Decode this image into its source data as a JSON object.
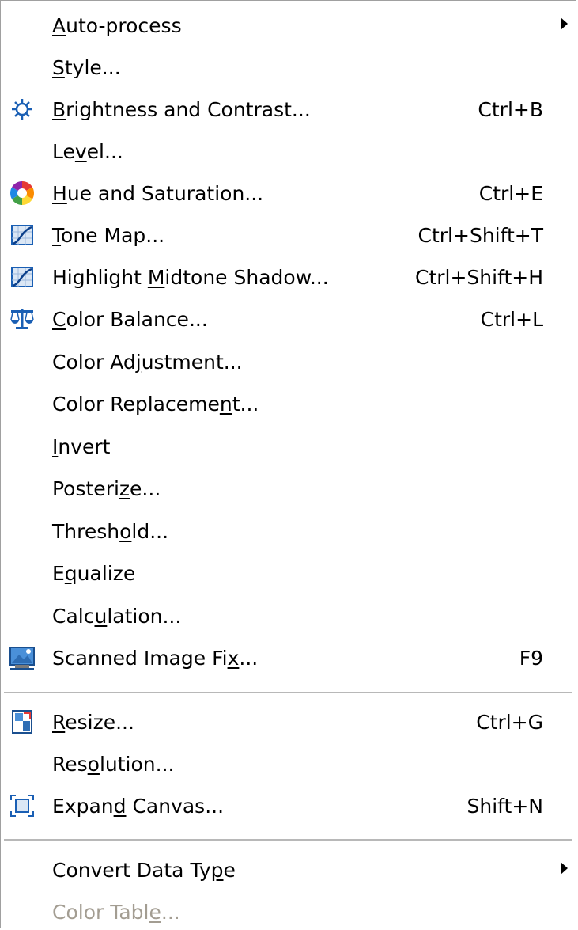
{
  "menu": {
    "items": [
      {
        "id": "auto-process",
        "pre": "",
        "ul": "A",
        "post": "uto-process",
        "shortcut": "",
        "submenu": true,
        "icon": "",
        "disabled": false
      },
      {
        "id": "style",
        "pre": "",
        "ul": "S",
        "post": "tyle...",
        "shortcut": "",
        "submenu": false,
        "icon": "",
        "disabled": false
      },
      {
        "id": "brightness-contrast",
        "pre": "",
        "ul": "B",
        "post": "rightness and Contrast...",
        "shortcut": "Ctrl+B",
        "submenu": false,
        "icon": "sun-icon",
        "disabled": false
      },
      {
        "id": "level",
        "pre": "Le",
        "ul": "v",
        "post": "el...",
        "shortcut": "",
        "submenu": false,
        "icon": "",
        "disabled": false
      },
      {
        "id": "hue-saturation",
        "pre": "",
        "ul": "H",
        "post": "ue and Saturation...",
        "shortcut": "Ctrl+E",
        "submenu": false,
        "icon": "color-wheel-icon",
        "disabled": false
      },
      {
        "id": "tone-map",
        "pre": "",
        "ul": "T",
        "post": "one Map...",
        "shortcut": "Ctrl+Shift+T",
        "submenu": false,
        "icon": "curve-graph-icon",
        "disabled": false
      },
      {
        "id": "highlight-midtone-shadow",
        "pre": "Highlight ",
        "ul": "M",
        "post": "idtone Shadow...",
        "shortcut": "Ctrl+Shift+H",
        "submenu": false,
        "icon": "curve-graph-icon",
        "disabled": false
      },
      {
        "id": "color-balance",
        "pre": "",
        "ul": "C",
        "post": "olor Balance...",
        "shortcut": "Ctrl+L",
        "submenu": false,
        "icon": "balance-scale-icon",
        "disabled": false
      },
      {
        "id": "color-adjustment",
        "pre": "Color Ad",
        "ul": "j",
        "post": "ustment...",
        "shortcut": "",
        "submenu": false,
        "icon": "",
        "disabled": false
      },
      {
        "id": "color-replacement",
        "pre": "Color Replaceme",
        "ul": "n",
        "post": "t...",
        "shortcut": "",
        "submenu": false,
        "icon": "",
        "disabled": false
      },
      {
        "id": "invert",
        "pre": "",
        "ul": "I",
        "post": "nvert",
        "shortcut": "",
        "submenu": false,
        "icon": "",
        "disabled": false
      },
      {
        "id": "posterize",
        "pre": "Posteri",
        "ul": "z",
        "post": "e...",
        "shortcut": "",
        "submenu": false,
        "icon": "",
        "disabled": false
      },
      {
        "id": "threshold",
        "pre": "Thresh",
        "ul": "o",
        "post": "ld...",
        "shortcut": "",
        "submenu": false,
        "icon": "",
        "disabled": false
      },
      {
        "id": "equalize",
        "pre": "E",
        "ul": "q",
        "post": "ualize",
        "shortcut": "",
        "submenu": false,
        "icon": "",
        "disabled": false
      },
      {
        "id": "calculation",
        "pre": "Calc",
        "ul": "u",
        "post": "lation...",
        "shortcut": "",
        "submenu": false,
        "icon": "",
        "disabled": false
      },
      {
        "id": "scanned-image-fix",
        "pre": "Scanned Image Fi",
        "ul": "x",
        "post": "...",
        "shortcut": "F9",
        "submenu": false,
        "icon": "scanned-image-icon",
        "disabled": false
      },
      {
        "id": "resize",
        "pre": "",
        "ul": "R",
        "post": "esize...",
        "shortcut": "Ctrl+G",
        "submenu": false,
        "icon": "resize-icon",
        "disabled": false
      },
      {
        "id": "resolution",
        "pre": "Res",
        "ul": "o",
        "post": "lution...",
        "shortcut": "",
        "submenu": false,
        "icon": "",
        "disabled": false
      },
      {
        "id": "expand-canvas",
        "pre": "Expan",
        "ul": "d",
        "post": " Canvas...",
        "shortcut": "Shift+N",
        "submenu": false,
        "icon": "expand-canvas-icon",
        "disabled": false
      },
      {
        "id": "convert-data-type",
        "pre": "Convert Data Ty",
        "ul": "p",
        "post": "e",
        "shortcut": "",
        "submenu": true,
        "icon": "",
        "disabled": false
      },
      {
        "id": "color-table",
        "pre": "Color Tabl",
        "ul": "e",
        "post": "...",
        "shortcut": "",
        "submenu": false,
        "icon": "",
        "disabled": true
      }
    ],
    "colors": {
      "text": "#000000",
      "disabled": "#a39d92",
      "separator": "#b8b8b8",
      "border": "#a0a0a0"
    }
  }
}
